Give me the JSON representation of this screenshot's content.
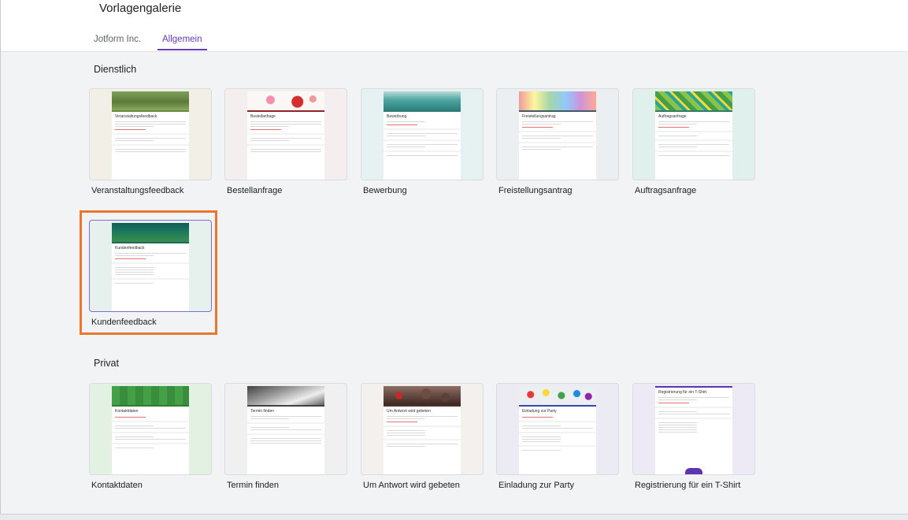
{
  "header": {
    "title": "Vorlagengalerie",
    "tabs": [
      {
        "label": "Jotform Inc.",
        "active": false
      },
      {
        "label": "Allgemein",
        "active": true
      }
    ]
  },
  "sections": [
    {
      "title": "Dienstlich",
      "templates": [
        {
          "label": "Veranstaltungsfeedback",
          "form_title": "Veranstaltungsfeedback"
        },
        {
          "label": "Bestellanfrage",
          "form_title": "Bestellanfrage"
        },
        {
          "label": "Bewerbung",
          "form_title": "Bewerbung"
        },
        {
          "label": "Freistellungsantrag",
          "form_title": "Freistellungsantrag"
        },
        {
          "label": "Auftragsanfrage",
          "form_title": "Auftragsanfrage"
        },
        {
          "label": "Kundenfeedback",
          "form_title": "Kundenfeedback",
          "selected": true
        }
      ]
    },
    {
      "title": "Privat",
      "templates": [
        {
          "label": "Kontaktdaten",
          "form_title": "Kontaktdaten"
        },
        {
          "label": "Termin finden",
          "form_title": "Termin finden"
        },
        {
          "label": "Um Antwort wird gebeten",
          "form_title": "Um Antwort wird gebeten"
        },
        {
          "label": "Einladung zur Party",
          "form_title": "Einladung zur Party"
        },
        {
          "label": "Registrierung für ein T-Shirt",
          "form_title": "Registrierung für ein T-Shirt"
        }
      ]
    }
  ],
  "colors": {
    "accent": "#673ab7",
    "highlight": "#e8762d",
    "gallery_bg": "#f1f3f4"
  }
}
